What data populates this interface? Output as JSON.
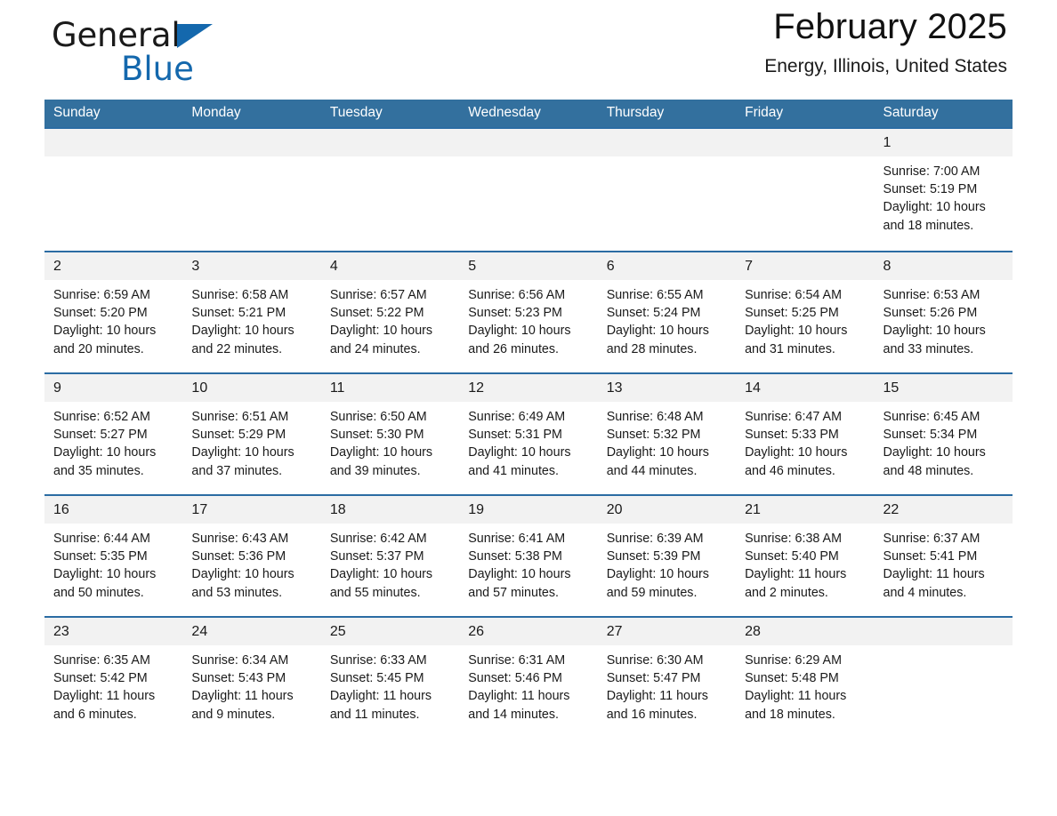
{
  "brand": {
    "name_part1": "General",
    "name_part2": "Blue",
    "accent_color": "#1468ad"
  },
  "header": {
    "title": "February 2025",
    "subtitle": "Energy, Illinois, United States",
    "header_bg": "#33709e",
    "row_rule_color": "#2b6ca3",
    "daynum_bg": "#f2f2f2"
  },
  "weekdays": [
    "Sunday",
    "Monday",
    "Tuesday",
    "Wednesday",
    "Thursday",
    "Friday",
    "Saturday"
  ],
  "weeks": [
    [
      {
        "day": "",
        "info": ""
      },
      {
        "day": "",
        "info": ""
      },
      {
        "day": "",
        "info": ""
      },
      {
        "day": "",
        "info": ""
      },
      {
        "day": "",
        "info": ""
      },
      {
        "day": "",
        "info": ""
      },
      {
        "day": "1",
        "info": "Sunrise: 7:00 AM\nSunset: 5:19 PM\nDaylight: 10 hours\nand 18 minutes."
      }
    ],
    [
      {
        "day": "2",
        "info": "Sunrise: 6:59 AM\nSunset: 5:20 PM\nDaylight: 10 hours\nand 20 minutes."
      },
      {
        "day": "3",
        "info": "Sunrise: 6:58 AM\nSunset: 5:21 PM\nDaylight: 10 hours\nand 22 minutes."
      },
      {
        "day": "4",
        "info": "Sunrise: 6:57 AM\nSunset: 5:22 PM\nDaylight: 10 hours\nand 24 minutes."
      },
      {
        "day": "5",
        "info": "Sunrise: 6:56 AM\nSunset: 5:23 PM\nDaylight: 10 hours\nand 26 minutes."
      },
      {
        "day": "6",
        "info": "Sunrise: 6:55 AM\nSunset: 5:24 PM\nDaylight: 10 hours\nand 28 minutes."
      },
      {
        "day": "7",
        "info": "Sunrise: 6:54 AM\nSunset: 5:25 PM\nDaylight: 10 hours\nand 31 minutes."
      },
      {
        "day": "8",
        "info": "Sunrise: 6:53 AM\nSunset: 5:26 PM\nDaylight: 10 hours\nand 33 minutes."
      }
    ],
    [
      {
        "day": "9",
        "info": "Sunrise: 6:52 AM\nSunset: 5:27 PM\nDaylight: 10 hours\nand 35 minutes."
      },
      {
        "day": "10",
        "info": "Sunrise: 6:51 AM\nSunset: 5:29 PM\nDaylight: 10 hours\nand 37 minutes."
      },
      {
        "day": "11",
        "info": "Sunrise: 6:50 AM\nSunset: 5:30 PM\nDaylight: 10 hours\nand 39 minutes."
      },
      {
        "day": "12",
        "info": "Sunrise: 6:49 AM\nSunset: 5:31 PM\nDaylight: 10 hours\nand 41 minutes."
      },
      {
        "day": "13",
        "info": "Sunrise: 6:48 AM\nSunset: 5:32 PM\nDaylight: 10 hours\nand 44 minutes."
      },
      {
        "day": "14",
        "info": "Sunrise: 6:47 AM\nSunset: 5:33 PM\nDaylight: 10 hours\nand 46 minutes."
      },
      {
        "day": "15",
        "info": "Sunrise: 6:45 AM\nSunset: 5:34 PM\nDaylight: 10 hours\nand 48 minutes."
      }
    ],
    [
      {
        "day": "16",
        "info": "Sunrise: 6:44 AM\nSunset: 5:35 PM\nDaylight: 10 hours\nand 50 minutes."
      },
      {
        "day": "17",
        "info": "Sunrise: 6:43 AM\nSunset: 5:36 PM\nDaylight: 10 hours\nand 53 minutes."
      },
      {
        "day": "18",
        "info": "Sunrise: 6:42 AM\nSunset: 5:37 PM\nDaylight: 10 hours\nand 55 minutes."
      },
      {
        "day": "19",
        "info": "Sunrise: 6:41 AM\nSunset: 5:38 PM\nDaylight: 10 hours\nand 57 minutes."
      },
      {
        "day": "20",
        "info": "Sunrise: 6:39 AM\nSunset: 5:39 PM\nDaylight: 10 hours\nand 59 minutes."
      },
      {
        "day": "21",
        "info": "Sunrise: 6:38 AM\nSunset: 5:40 PM\nDaylight: 11 hours\nand 2 minutes."
      },
      {
        "day": "22",
        "info": "Sunrise: 6:37 AM\nSunset: 5:41 PM\nDaylight: 11 hours\nand 4 minutes."
      }
    ],
    [
      {
        "day": "23",
        "info": "Sunrise: 6:35 AM\nSunset: 5:42 PM\nDaylight: 11 hours\nand 6 minutes."
      },
      {
        "day": "24",
        "info": "Sunrise: 6:34 AM\nSunset: 5:43 PM\nDaylight: 11 hours\nand 9 minutes."
      },
      {
        "day": "25",
        "info": "Sunrise: 6:33 AM\nSunset: 5:45 PM\nDaylight: 11 hours\nand 11 minutes."
      },
      {
        "day": "26",
        "info": "Sunrise: 6:31 AM\nSunset: 5:46 PM\nDaylight: 11 hours\nand 14 minutes."
      },
      {
        "day": "27",
        "info": "Sunrise: 6:30 AM\nSunset: 5:47 PM\nDaylight: 11 hours\nand 16 minutes."
      },
      {
        "day": "28",
        "info": "Sunrise: 6:29 AM\nSunset: 5:48 PM\nDaylight: 11 hours\nand 18 minutes."
      },
      {
        "day": "",
        "info": ""
      }
    ]
  ]
}
